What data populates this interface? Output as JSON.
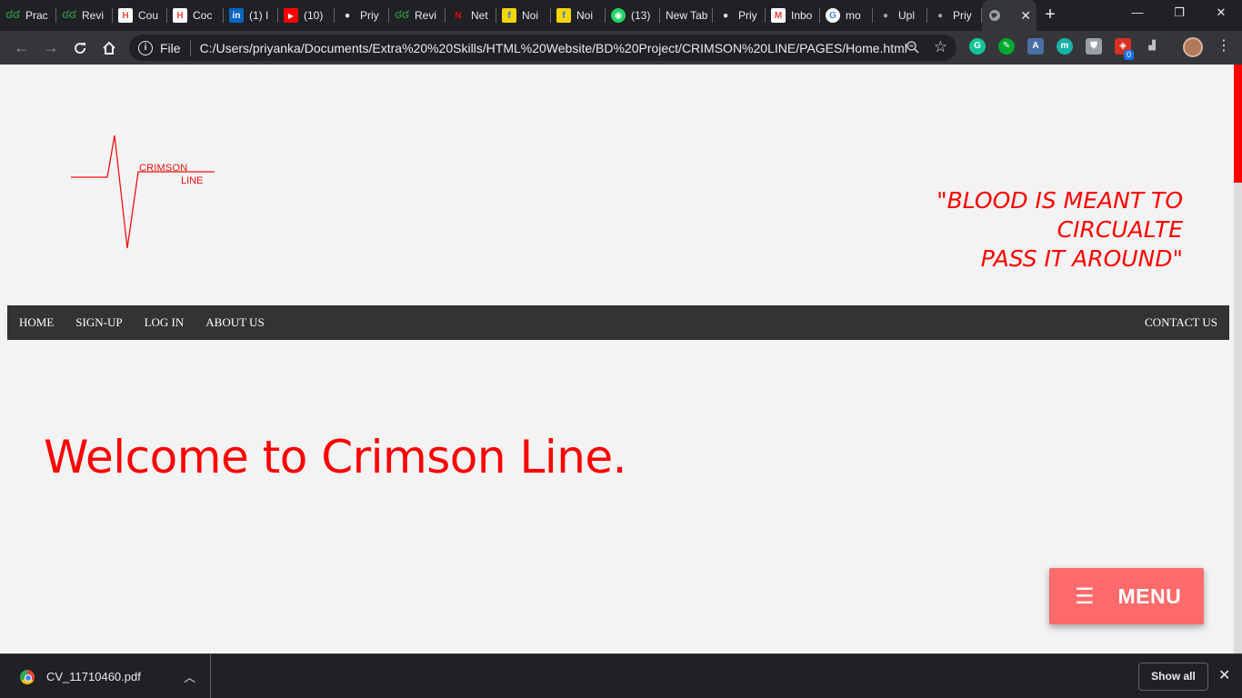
{
  "browser": {
    "tabs": [
      {
        "label": "Prac",
        "icon": "gg-icon",
        "color": "#2f8d46"
      },
      {
        "label": "Revi",
        "icon": "gg-icon",
        "color": "#2f8d46"
      },
      {
        "label": "Cou",
        "icon": "hackerrank-icon",
        "color": "#e74c3c"
      },
      {
        "label": "Coc",
        "icon": "hackerrank-icon",
        "color": "#e74c3c"
      },
      {
        "label": "(1) I",
        "icon": "linkedin-icon",
        "color": "#0a66c2"
      },
      {
        "label": "(10)",
        "icon": "youtube-icon",
        "color": "#ff0000"
      },
      {
        "label": "Priy",
        "icon": "github-icon",
        "color": "#ffffff"
      },
      {
        "label": "Revi",
        "icon": "gg-icon",
        "color": "#2f8d46"
      },
      {
        "label": "Net",
        "icon": "netflix-icon",
        "color": "#e50914"
      },
      {
        "label": "Noi",
        "icon": "flipkart-icon",
        "color": "#f7d600"
      },
      {
        "label": "Noi",
        "icon": "flipkart-icon",
        "color": "#f7d600"
      },
      {
        "label": "(13)",
        "icon": "whatsapp-icon",
        "color": "#25d366"
      },
      {
        "label": "New Tab",
        "icon": "none",
        "color": "#e8eaed"
      },
      {
        "label": "Priy",
        "icon": "github-icon",
        "color": "#ffffff"
      },
      {
        "label": "Inbo",
        "icon": "gmail-icon",
        "color": "#ea4335"
      },
      {
        "label": "mo",
        "icon": "google-icon",
        "color": "#4285f4"
      },
      {
        "label": "Upl",
        "icon": "globe-icon",
        "color": "#9aa0a6"
      },
      {
        "label": "Priy",
        "icon": "globe-icon",
        "color": "#9aa0a6"
      }
    ],
    "active_tab_icon": "globe-icon",
    "address": {
      "scheme_label": "File",
      "url": "C:/Users/priyanka/Documents/Extra%20%20Skills/HTML%20Website/BD%20Project/CRIMSON%20LINE/PAGES/Home.html"
    },
    "extension_badge": "0"
  },
  "site": {
    "logo": {
      "line1": "CRIMSON",
      "line2": "LINE"
    },
    "quote": {
      "line1": "\"BLOOD IS MEANT TO",
      "line2": "CIRCUALTE",
      "line3": "PASS IT AROUND\""
    },
    "nav": {
      "home": "HOME",
      "signup": "SIGN-UP",
      "login": "LOG IN",
      "about": "ABOUT US",
      "contact": "CONTACT US"
    },
    "welcome": "Welcome to Crimson Line.",
    "menu_button": {
      "label": "MENU",
      "icon": "hamburger-icon"
    },
    "colors": {
      "accent": "#ff0000",
      "navbar": "#333333",
      "menu": "#ff6b6b"
    }
  },
  "downloads": {
    "file_name": "CV_11710460.pdf",
    "show_all": "Show all"
  }
}
